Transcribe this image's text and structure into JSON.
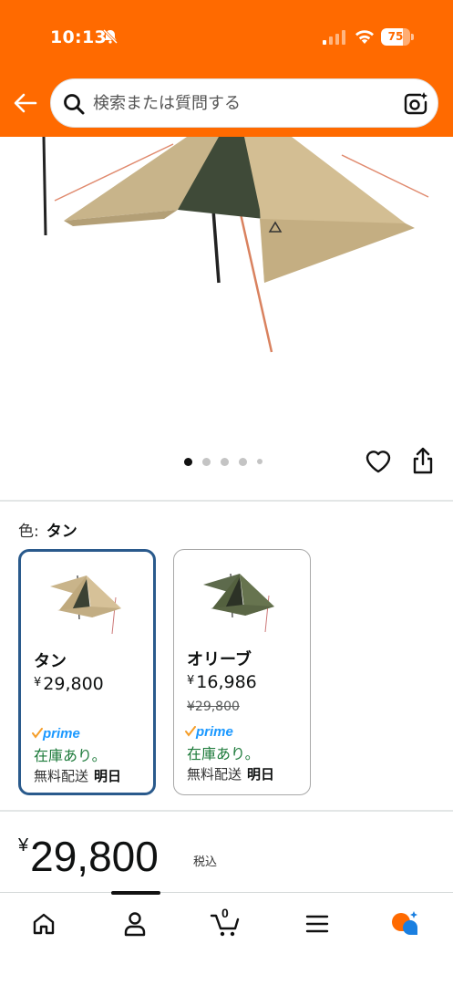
{
  "status_bar": {
    "time": "10:13",
    "battery_level": 75,
    "battery_text": "75"
  },
  "header": {
    "accent_color": "#ff6a00",
    "search": {
      "placeholder": "検索または質問する"
    }
  },
  "product": {
    "image_count": 5,
    "active_image_index": 0
  },
  "color_selection": {
    "label": "色:",
    "selected": "タン",
    "options": [
      {
        "name": "タン",
        "price_symbol": "¥",
        "price": "29,800",
        "old_price": "",
        "prime": "prime",
        "stock": "在庫あり。",
        "delivery_label": "無料配送",
        "delivery_day": "明日",
        "selected": true
      },
      {
        "name": "オリーブ",
        "price_symbol": "¥",
        "price": "16,986",
        "old_price": "¥29,800",
        "prime": "prime",
        "stock": "在庫あり。",
        "delivery_label": "無料配送",
        "delivery_day": "明日",
        "selected": false
      }
    ]
  },
  "price": {
    "symbol": "¥",
    "amount": "29,800",
    "tax": "税込"
  },
  "bottom_nav": {
    "cart_count": "0",
    "items": [
      "home-icon",
      "account-icon",
      "cart-icon",
      "menu-icon",
      "rufus-icon"
    ]
  }
}
